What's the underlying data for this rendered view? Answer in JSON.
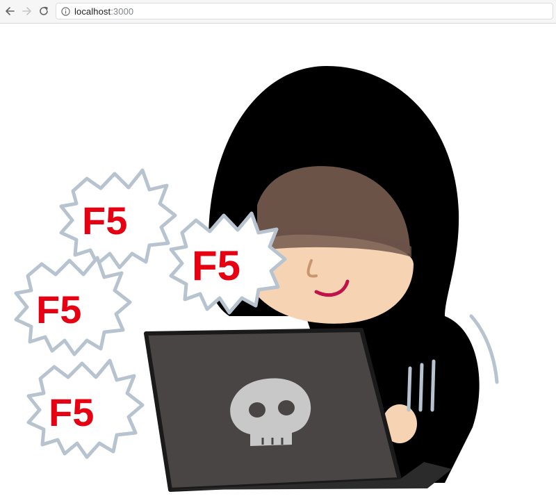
{
  "browser": {
    "url_host": "localhost",
    "url_port": ":3000",
    "back_icon": "arrow-left-icon",
    "forward_icon": "arrow-right-icon",
    "reload_icon": "reload-icon",
    "info_icon": "info-icon"
  },
  "illustration": {
    "bubbles": [
      {
        "label": "F5"
      },
      {
        "label": "F5"
      },
      {
        "label": "F5"
      },
      {
        "label": "F5"
      }
    ]
  },
  "colors": {
    "hood": "#000000",
    "skin": "#f6d3b3",
    "shadow": "#6b5348",
    "laptop": "#4a4545",
    "skull": "#c8c8c8",
    "f5_text": "#e60012",
    "bubble_outline": "#b7c3cf"
  }
}
